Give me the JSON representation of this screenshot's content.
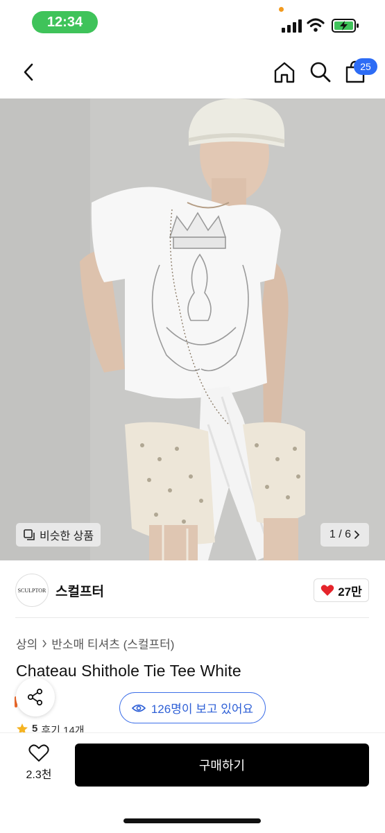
{
  "status_bar": {
    "time": "12:34"
  },
  "nav": {
    "cart_count": "25"
  },
  "image": {
    "similar_label": "비슷한 상품",
    "page_indicator": "1 / 6"
  },
  "shop": {
    "logo_text": "SCULPTOR",
    "name": "스컬프터",
    "likes": "27만"
  },
  "breadcrumb": {
    "category": "상의",
    "subcategory": "반소매 티셔츠 (스컬프터)"
  },
  "product": {
    "title": "Chateau Shithole Tie Tee White",
    "viewers": "126명이 보고 있어요",
    "rating": "5",
    "reviews": "후기 14개"
  },
  "bottom": {
    "wish_count": "2.3천",
    "buy_label": "구매하기"
  },
  "colors": {
    "accent_blue": "#2d6cf5",
    "heart_red": "#e5242b",
    "status_green": "#3fc35a"
  },
  "icons": [
    "back-arrow-icon",
    "home-icon",
    "search-icon",
    "shopping-bag-icon",
    "copy-icon",
    "chevron-right-icon",
    "heart-icon",
    "share-icon",
    "eye-icon",
    "star-icon"
  ]
}
